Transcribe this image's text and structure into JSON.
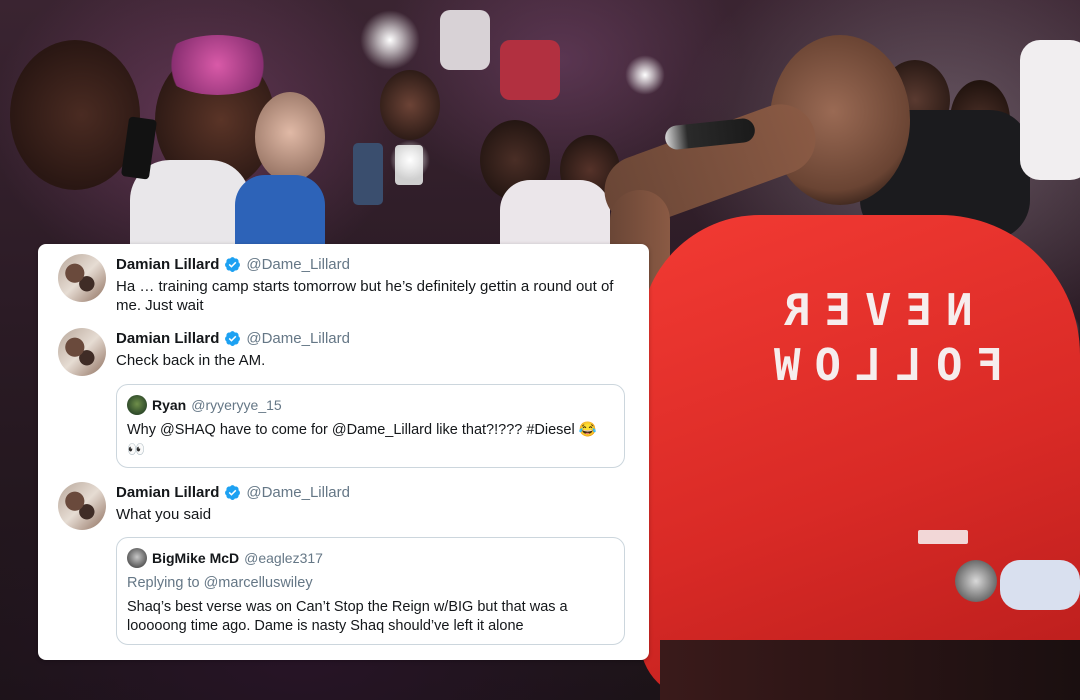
{
  "tweets": [
    {
      "name": "Damian Lillard",
      "handle": "@Dame_Lillard",
      "text": "Ha … training camp starts tomorrow but he’s definitely gettin a round out of me. Just wait"
    },
    {
      "name": "Damian Lillard",
      "handle": "@Dame_Lillard",
      "text": "Check back in the AM.",
      "quote": {
        "name": "Ryan",
        "handle": "@ryyeryye_15",
        "text": "Why @SHAQ have to come for @Dame_Lillard like that?!??? #Diesel 😂",
        "text2": "👀"
      }
    },
    {
      "name": "Damian Lillard",
      "handle": "@Dame_Lillard",
      "text": "What you said",
      "quote": {
        "name": "BigMike McD",
        "handle": "@eaglez317",
        "replying_prefix": "Replying to",
        "replying_to": "@marcelluswiley",
        "text": "Shaq’s best verse was on Can’t Stop the Reign w/BIG but that was a looooong time ago. Dame is nasty Shaq should’ve left it alone"
      }
    }
  ],
  "shirt": {
    "line1": "NEVER",
    "line2": "FOLLOW"
  },
  "icons": {
    "verified": "verified-badge-icon",
    "verified_color": "#1da1f2"
  }
}
